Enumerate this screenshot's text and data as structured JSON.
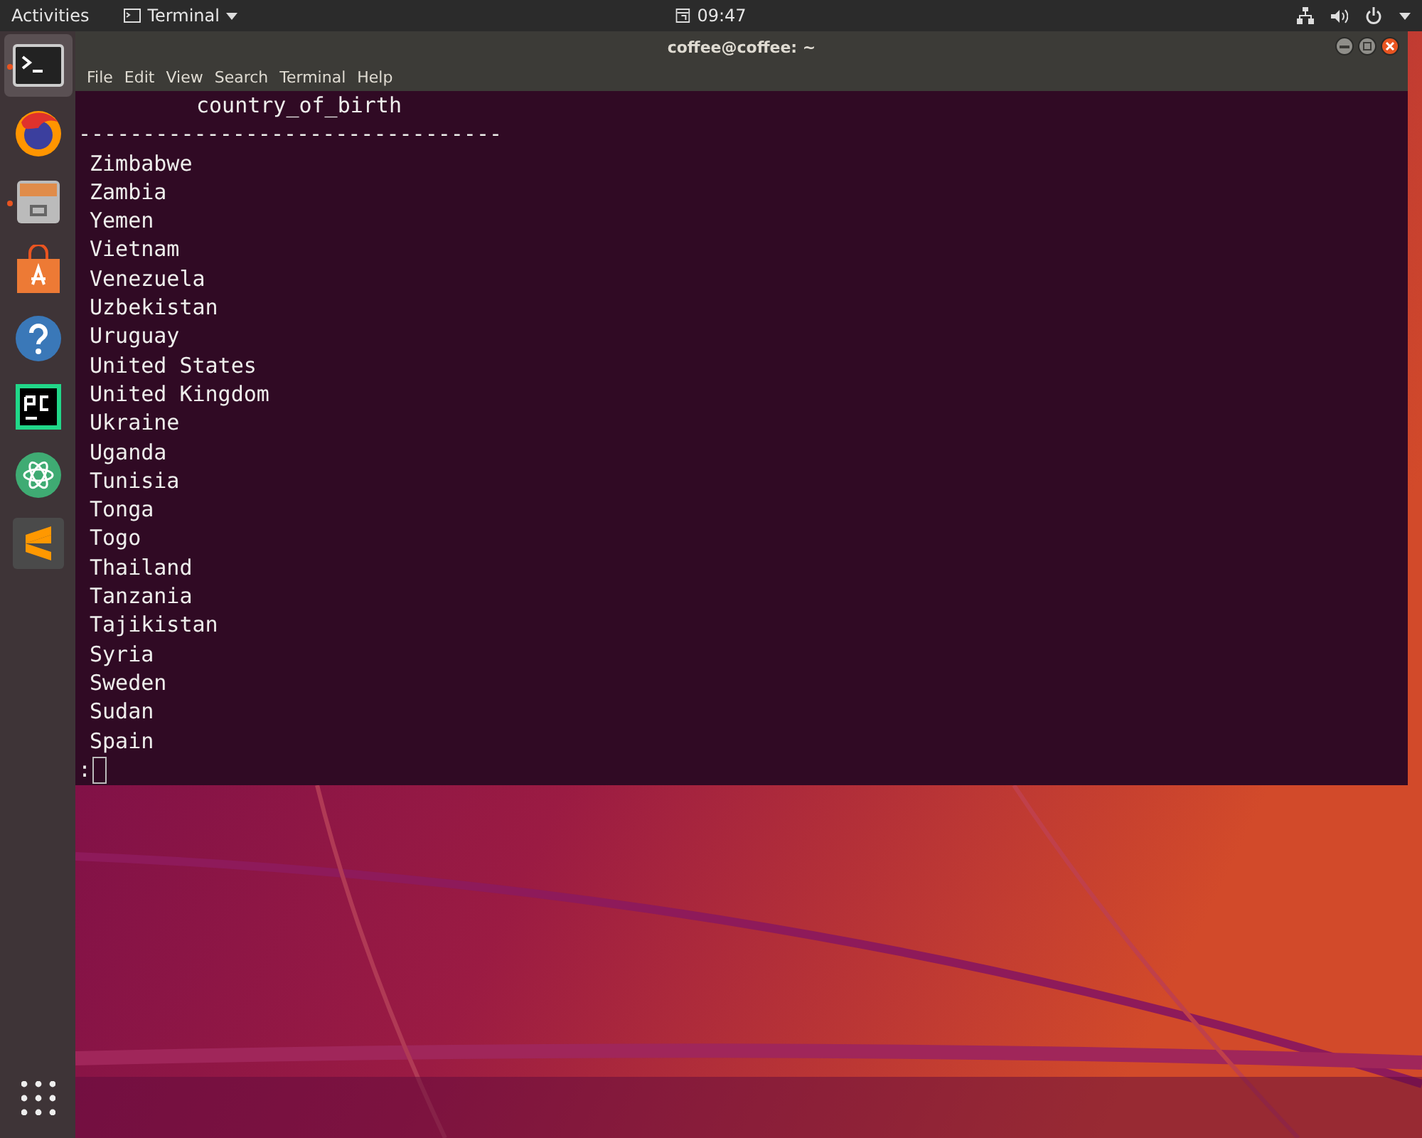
{
  "top_bar": {
    "activities": "Activities",
    "app_menu": "Terminal",
    "clock": "09:47"
  },
  "dock": {
    "items": [
      {
        "selected": true,
        "running": true
      },
      {
        "selected": false,
        "running": false
      },
      {
        "selected": false,
        "running": true
      },
      {
        "selected": false,
        "running": false
      },
      {
        "selected": false,
        "running": false
      },
      {
        "selected": false,
        "running": false
      },
      {
        "selected": false,
        "running": false
      },
      {
        "selected": false,
        "running": false
      }
    ]
  },
  "window": {
    "title": "coffee@coffee: ~",
    "menu": [
      "File",
      "Edit",
      "View",
      "Search",
      "Terminal",
      "Help"
    ]
  },
  "terminal": {
    "header": "country_of_birth",
    "separator": "---------------------------------",
    "rows": [
      "Zimbabwe",
      "Zambia",
      "Yemen",
      "Vietnam",
      "Venezuela",
      "Uzbekistan",
      "Uruguay",
      "United States",
      "United Kingdom",
      "Ukraine",
      "Uganda",
      "Tunisia",
      "Tonga",
      "Togo",
      "Thailand",
      "Tanzania",
      "Tajikistan",
      "Syria",
      "Sweden",
      "Sudan",
      "Spain"
    ],
    "prompt": ":"
  }
}
